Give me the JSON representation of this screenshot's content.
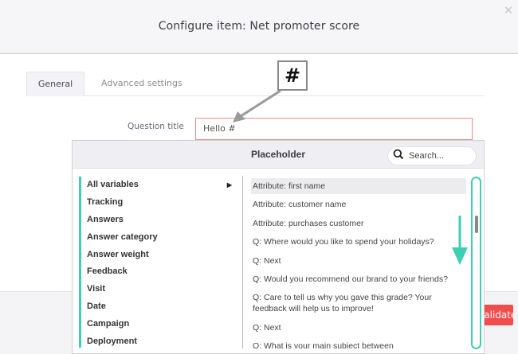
{
  "modal": {
    "title": "Configure item: Net promoter score",
    "close_label": "✕"
  },
  "tabs": [
    {
      "label": "General",
      "active": true
    },
    {
      "label": "Advanced settings",
      "active": false
    }
  ],
  "form": {
    "question_title_label": "Question title",
    "question_title_value": "Hello #"
  },
  "callout": {
    "symbol": "#"
  },
  "placeholder_panel": {
    "title": "Placeholder",
    "search_placeholder": "Search...",
    "categories": [
      {
        "label": "All variables",
        "has_arrow": true
      },
      {
        "label": "Tracking"
      },
      {
        "label": "Answers"
      },
      {
        "label": "Answer category"
      },
      {
        "label": "Answer weight"
      },
      {
        "label": "Feedback"
      },
      {
        "label": "Visit"
      },
      {
        "label": "Date"
      },
      {
        "label": "Campaign"
      },
      {
        "label": "Deployment"
      }
    ],
    "arrow_glyph": "▶",
    "items": [
      "Attribute: first name",
      "Attribute: customer name",
      "Attribute: purchases customer",
      "Q: Where would you like to spend your holidays?",
      "Q: Next",
      "Q: Would you recommend our brand to your friends?",
      "Q: Care to tell us why you gave this grade? Your feedback will help us to improve!",
      "Q: Next",
      "Q: What is your main subject between"
    ],
    "selected_index": 0
  },
  "footer": {
    "validate_label": "Validate"
  },
  "colors": {
    "accent_teal": "#3ecfb2",
    "validate_red": "#f24d4d",
    "input_error_border": "#f08a8a"
  }
}
